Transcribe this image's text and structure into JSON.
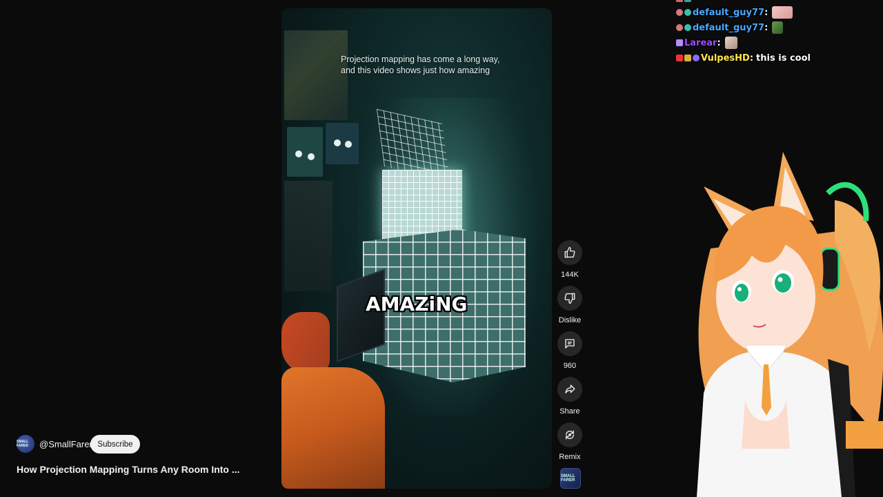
{
  "video": {
    "caption_line1": "Projection mapping has come a long way,",
    "caption_line2": "and this video shows just how amazing",
    "overlay_word": "AMAZiNG"
  },
  "actions": {
    "like_count": "144K",
    "dislike_label": "Dislike",
    "comment_count": "960",
    "share_label": "Share",
    "remix_label": "Remix"
  },
  "channel": {
    "handle": "@SmallFarer",
    "subscribe_label": "Subscribe",
    "avatar_text": "SMALL FARER"
  },
  "video_title": "How Projection Mapping Turns Any Room Into ...",
  "chat": {
    "messages": [
      {
        "user": "default_guy77",
        "user_color": "#4aa8ff",
        "text": ""
      },
      {
        "user": "default_guy77",
        "user_color": "#4aa8ff",
        "text": ""
      },
      {
        "user": "Larear",
        "user_color": "#9b4dff",
        "text": ""
      },
      {
        "user": "VulpesHD",
        "user_color": "#ffe94a",
        "text": "this is cool"
      }
    ]
  },
  "colors": {
    "background": "#0b0b0b",
    "button_bg": "#272727",
    "subscribe_bg": "#f1f1f1"
  }
}
